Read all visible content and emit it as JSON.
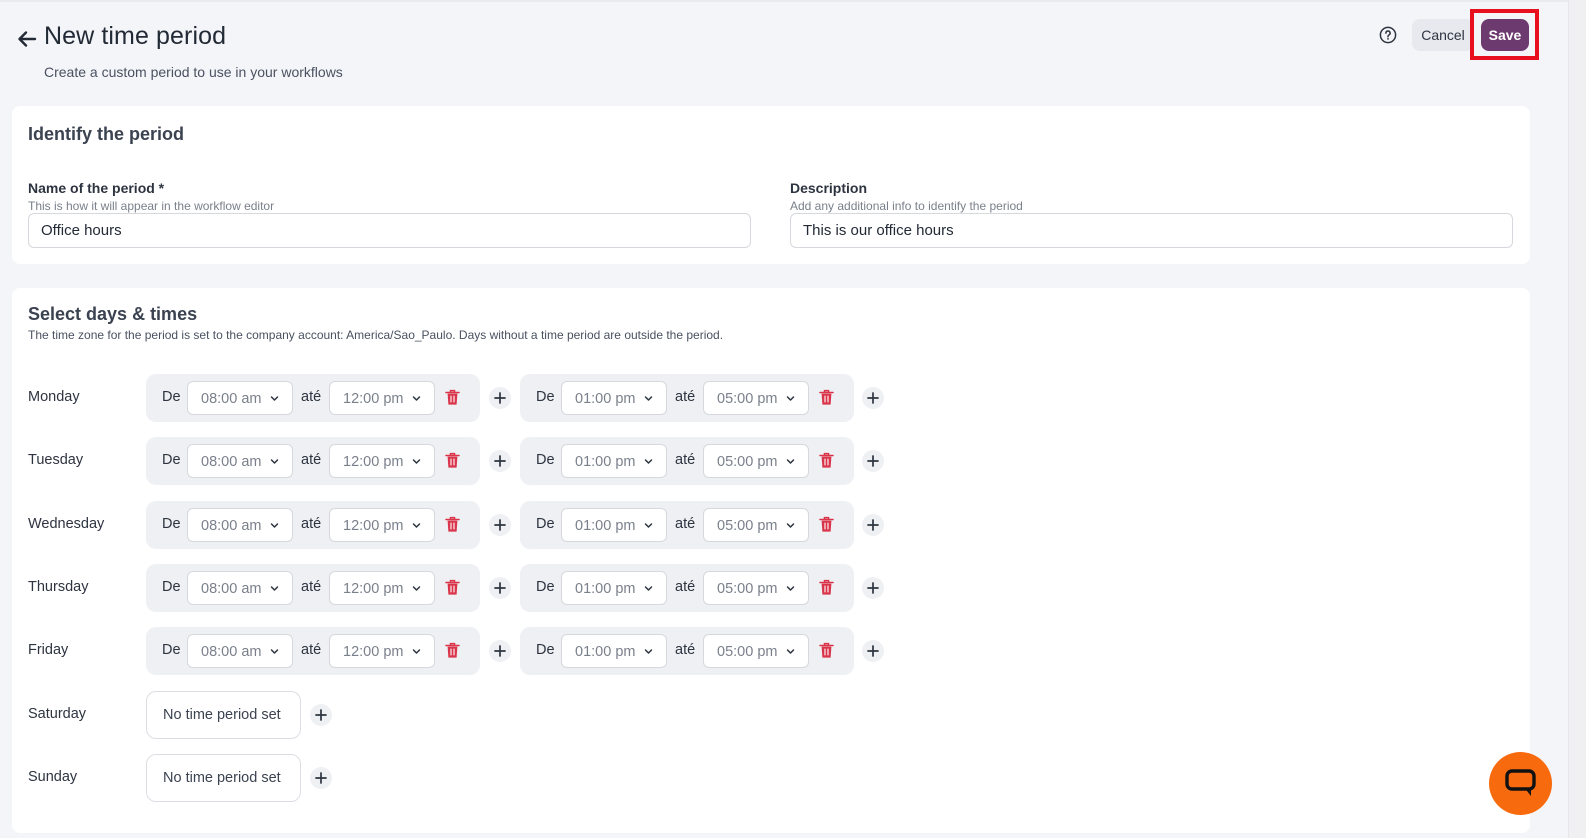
{
  "header": {
    "title": "New time period",
    "subtitle": "Create a custom period to use in your workflows",
    "cancel_label": "Cancel",
    "save_label": "Save",
    "help_icon": "question-circle-icon",
    "back_icon": "arrow-left-icon"
  },
  "identify": {
    "section_title": "Identify the period",
    "name_field": {
      "label": "Name of the period *",
      "hint": "This is how it will appear in the workflow editor",
      "value": "Office hours"
    },
    "description_field": {
      "label": "Description",
      "hint": "Add any additional info to identify the period",
      "value": "This is our office hours"
    }
  },
  "schedule": {
    "section_title": "Select days & times",
    "timezone_note": "The time zone for the period is set to the company account: America/Sao_Paulo. Days without a time period are outside the period.",
    "from_word": "De",
    "to_word": "até",
    "empty_text": "No time period set",
    "days": [
      {
        "name": "Monday",
        "periods": [
          {
            "start": "08:00 am",
            "end": "12:00 pm"
          },
          {
            "start": "01:00 pm",
            "end": "05:00 pm"
          }
        ]
      },
      {
        "name": "Tuesday",
        "periods": [
          {
            "start": "08:00 am",
            "end": "12:00 pm"
          },
          {
            "start": "01:00 pm",
            "end": "05:00 pm"
          }
        ]
      },
      {
        "name": "Wednesday",
        "periods": [
          {
            "start": "08:00 am",
            "end": "12:00 pm"
          },
          {
            "start": "01:00 pm",
            "end": "05:00 pm"
          }
        ]
      },
      {
        "name": "Thursday",
        "periods": [
          {
            "start": "08:00 am",
            "end": "12:00 pm"
          },
          {
            "start": "01:00 pm",
            "end": "05:00 pm"
          }
        ]
      },
      {
        "name": "Friday",
        "periods": [
          {
            "start": "08:00 am",
            "end": "12:00 pm"
          },
          {
            "start": "01:00 pm",
            "end": "05:00 pm"
          }
        ]
      },
      {
        "name": "Saturday",
        "periods": []
      },
      {
        "name": "Sunday",
        "periods": []
      }
    ]
  },
  "colors": {
    "save_bg": "#6d3a6f",
    "highlight_frame": "#e8101e",
    "trash": "#d9344a",
    "chat_bg": "#f76b0e"
  },
  "chat_icon": "chat-bubble-icon"
}
